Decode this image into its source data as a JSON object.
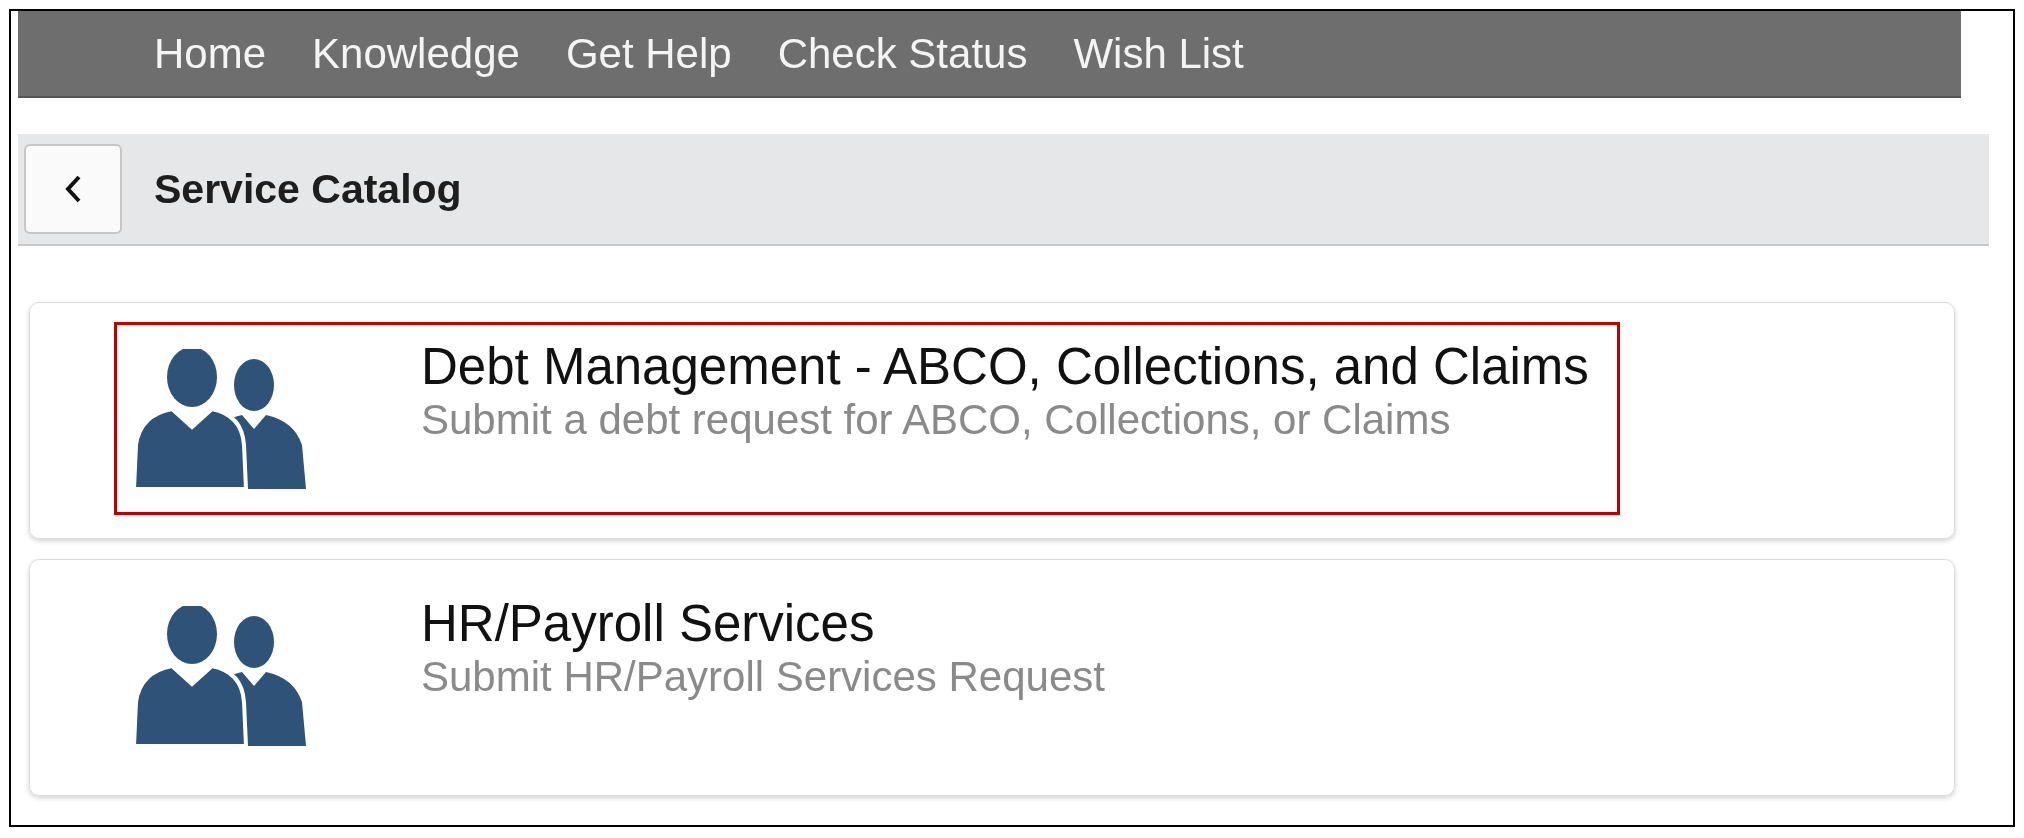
{
  "nav": {
    "items": [
      "Home",
      "Knowledge",
      "Get Help",
      "Check Status",
      "Wish List"
    ]
  },
  "header": {
    "title": "Service Catalog"
  },
  "catalog": [
    {
      "title": "Debt Management - ABCO, Collections, and Claims",
      "description": "Submit a debt request for ABCO, Collections, or Claims",
      "highlighted": true
    },
    {
      "title": "HR/Payroll Services",
      "description": "Submit HR/Payroll Services Request",
      "highlighted": false
    }
  ]
}
